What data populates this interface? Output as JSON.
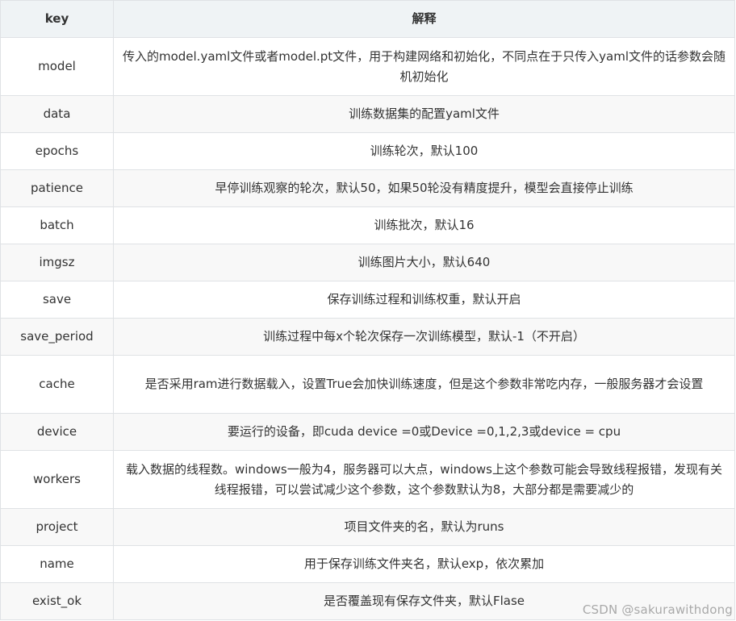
{
  "table": {
    "header": {
      "key": "key",
      "desc": "解释"
    },
    "rows": [
      {
        "key": "model",
        "desc": "传入的model.yaml文件或者model.pt文件，用于构建网络和初始化，不同点在于只传入yaml文件的话参数会随机初始化"
      },
      {
        "key": "data",
        "desc": "训练数据集的配置yaml文件"
      },
      {
        "key": "epochs",
        "desc": "训练轮次，默认100"
      },
      {
        "key": "patience",
        "desc": "早停训练观察的轮次，默认50，如果50轮没有精度提升，模型会直接停止训练"
      },
      {
        "key": "batch",
        "desc": "训练批次，默认16"
      },
      {
        "key": "imgsz",
        "desc": "训练图片大小，默认640"
      },
      {
        "key": "save",
        "desc": "保存训练过程和训练权重，默认开启"
      },
      {
        "key": "save_period",
        "desc": "训练过程中每x个轮次保存一次训练模型，默认-1（不开启）"
      },
      {
        "key": "cache",
        "desc": "是否采用ram进行数据载入，设置True会加快训练速度，但是这个参数非常吃内存，一般服务器才会设置"
      },
      {
        "key": "device",
        "desc": "要运行的设备，即cuda device =0或Device =0,1,2,3或device = cpu"
      },
      {
        "key": "workers",
        "desc": "载入数据的线程数。windows一般为4，服务器可以大点，windows上这个参数可能会导致线程报错，发现有关线程报错，可以尝试减少这个参数，这个参数默认为8，大部分都是需要减少的"
      },
      {
        "key": "project",
        "desc": "项目文件夹的名，默认为runs"
      },
      {
        "key": "name",
        "desc": "用于保存训练文件夹名，默认exp，依次累加"
      },
      {
        "key": "exist_ok",
        "desc": "是否覆盖现有保存文件夹，默认Flase"
      }
    ]
  },
  "watermark": "CSDN @sakurawithdong"
}
